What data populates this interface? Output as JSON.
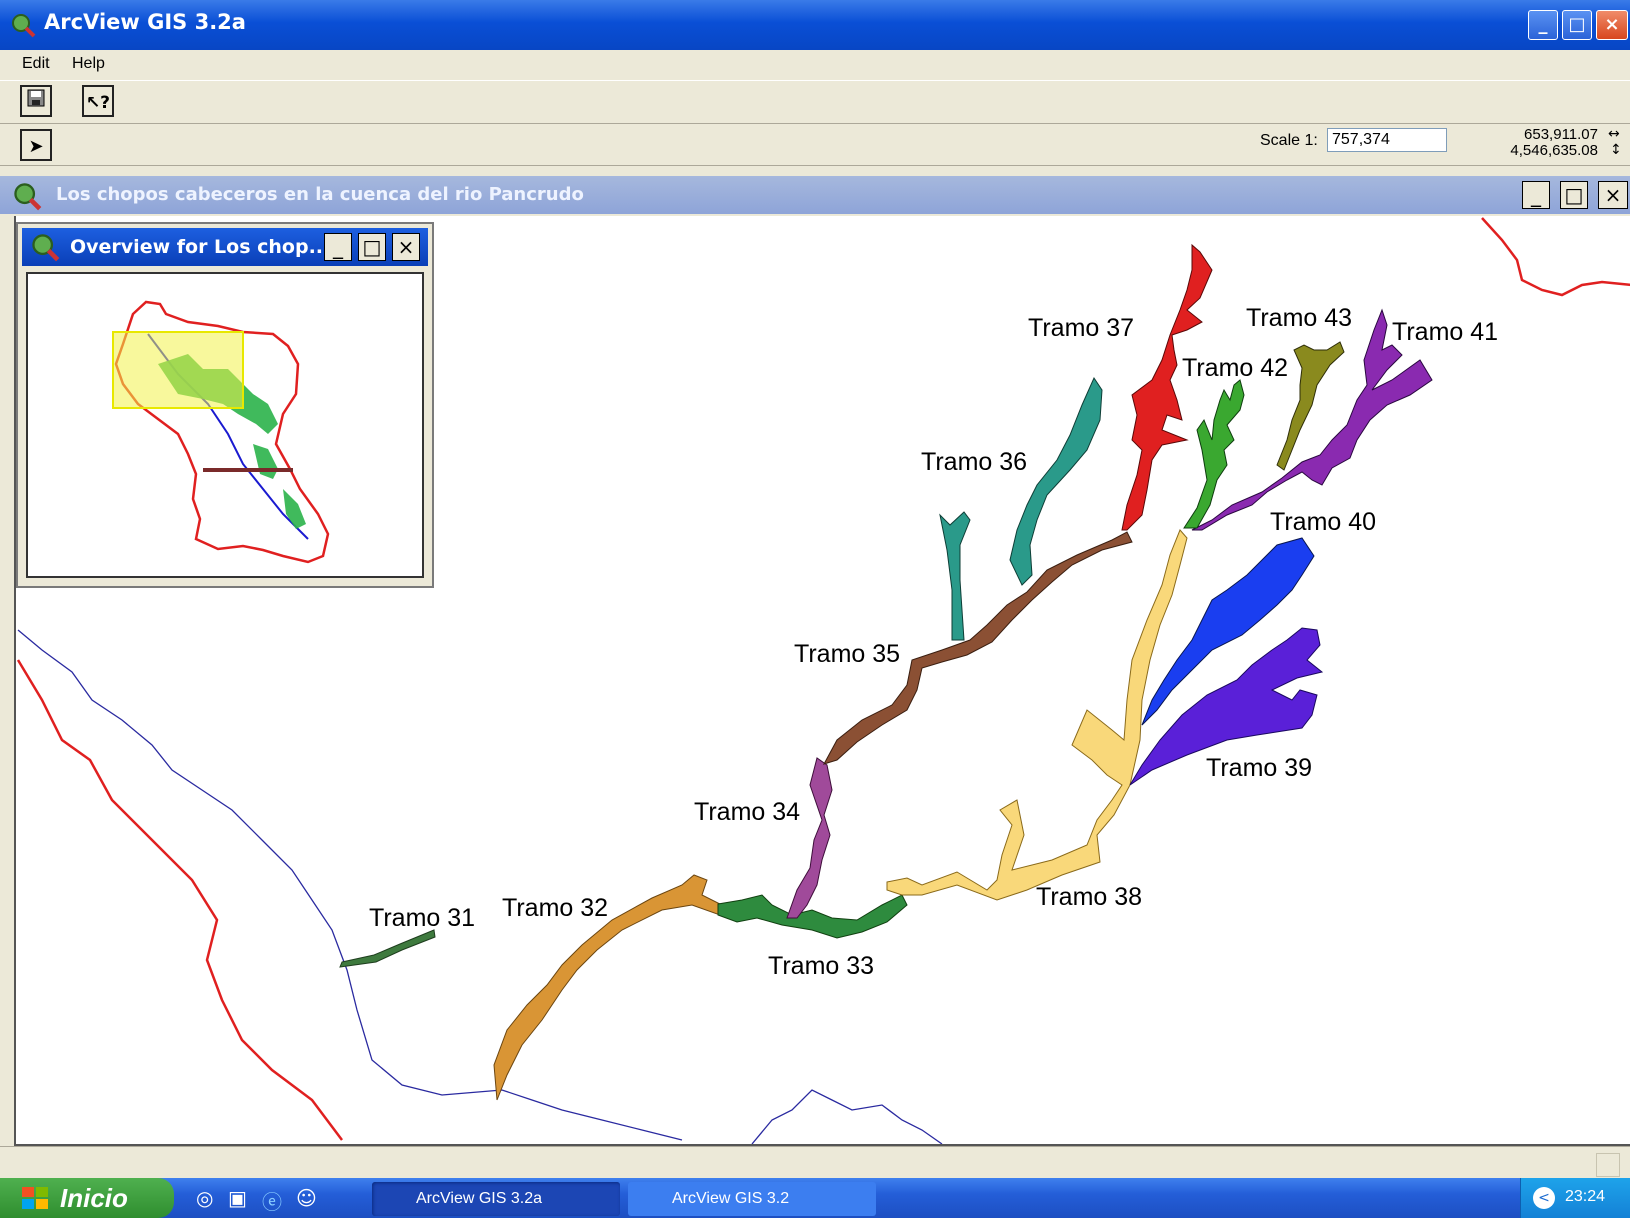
{
  "window": {
    "title": "ArcView GIS 3.2a"
  },
  "menu": {
    "items": [
      "Edit",
      "Help"
    ]
  },
  "toolbar": {
    "scale_label": "Scale 1:",
    "scale_value": "757,374",
    "coord_x": "653,911.07",
    "coord_y": "4,546,635.08"
  },
  "view": {
    "title": "Los chopos cabeceros en la cuenca del rio Pancrudo"
  },
  "overview": {
    "title": "Overview for Los chop..."
  },
  "map": {
    "labels": [
      "Tramo 31",
      "Tramo 32",
      "Tramo 33",
      "Tramo 34",
      "Tramo 35",
      "Tramo 36",
      "Tramo 37",
      "Tramo 38",
      "Tramo 39",
      "Tramo 40",
      "Tramo 41",
      "Tramo 42",
      "Tramo 43"
    ],
    "colors": {
      "tramo31": "#3e7a3e",
      "tramo32": "#d99535",
      "tramo33": "#2e8b3e",
      "tramo34": "#a04a9a",
      "tramo35": "#8b5034",
      "tramo36": "#2a9a8a",
      "tramo37": "#e02020",
      "tramo38": "#f9d87a",
      "tramo39": "#5a20d8",
      "tramo40": "#1a3ef0",
      "tramo41": "#8a2ab0",
      "tramo42": "#3aa830",
      "tramo43": "#8a8a1e",
      "boundary": "#e02020",
      "river": "#2a2aa0"
    }
  },
  "taskbar": {
    "start": "Inicio",
    "tasks": [
      "ArcView GIS 3.2a",
      "ArcView GIS 3.2"
    ],
    "clock": "23:24"
  }
}
